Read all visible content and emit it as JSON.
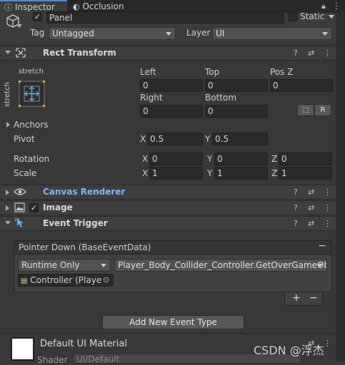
{
  "tabs": {
    "inspector": "Inspector",
    "occlusion": "Occlusion"
  },
  "object": {
    "name": "Panel",
    "static_label": "Static",
    "tag_label": "Tag",
    "tag_value": "Untagged",
    "layer_label": "Layer",
    "layer_value": "UI"
  },
  "rect_transform": {
    "title": "Rect Transform",
    "anchor_preset_top": "stretch",
    "anchor_preset_side": "stretch",
    "left_label": "Left",
    "left_value": "0",
    "top_label": "Top",
    "top_value": "0",
    "posz_label": "Pos Z",
    "posz_value": "0",
    "right_label": "Right",
    "right_value": "0",
    "bottom_label": "Bottom",
    "bottom_value": "0",
    "raw_button": "R",
    "anchors_label": "Anchors",
    "pivot_label": "Pivot",
    "pivot_x": "0.5",
    "pivot_y": "0.5",
    "rotation_label": "Rotation",
    "rot_x": "0",
    "rot_y": "0",
    "rot_z": "0",
    "scale_label": "Scale",
    "scale_x": "1",
    "scale_y": "1",
    "scale_z": "1",
    "axis_x": "X",
    "axis_y": "Y",
    "axis_z": "Z"
  },
  "canvas_renderer": {
    "title": "Canvas Renderer",
    "color": "#7eb6ff"
  },
  "image": {
    "title": "Image"
  },
  "event_trigger": {
    "title": "Event Trigger",
    "entry_title": "Pointer Down (BaseEventData)",
    "remove_symbol": "−",
    "runtime_value": "Runtime Only",
    "function_value": "Player_Body_Collider_Controller.GetOverGameObj",
    "object_value": "Controller (Playe",
    "add_symbol": "+",
    "minus_symbol": "−",
    "add_event_button": "Add New Event Type"
  },
  "material": {
    "name": "Default UI Material",
    "shader_label": "Shader",
    "shader_value": "UI/Default"
  },
  "watermark": "CSDN @浮杰"
}
